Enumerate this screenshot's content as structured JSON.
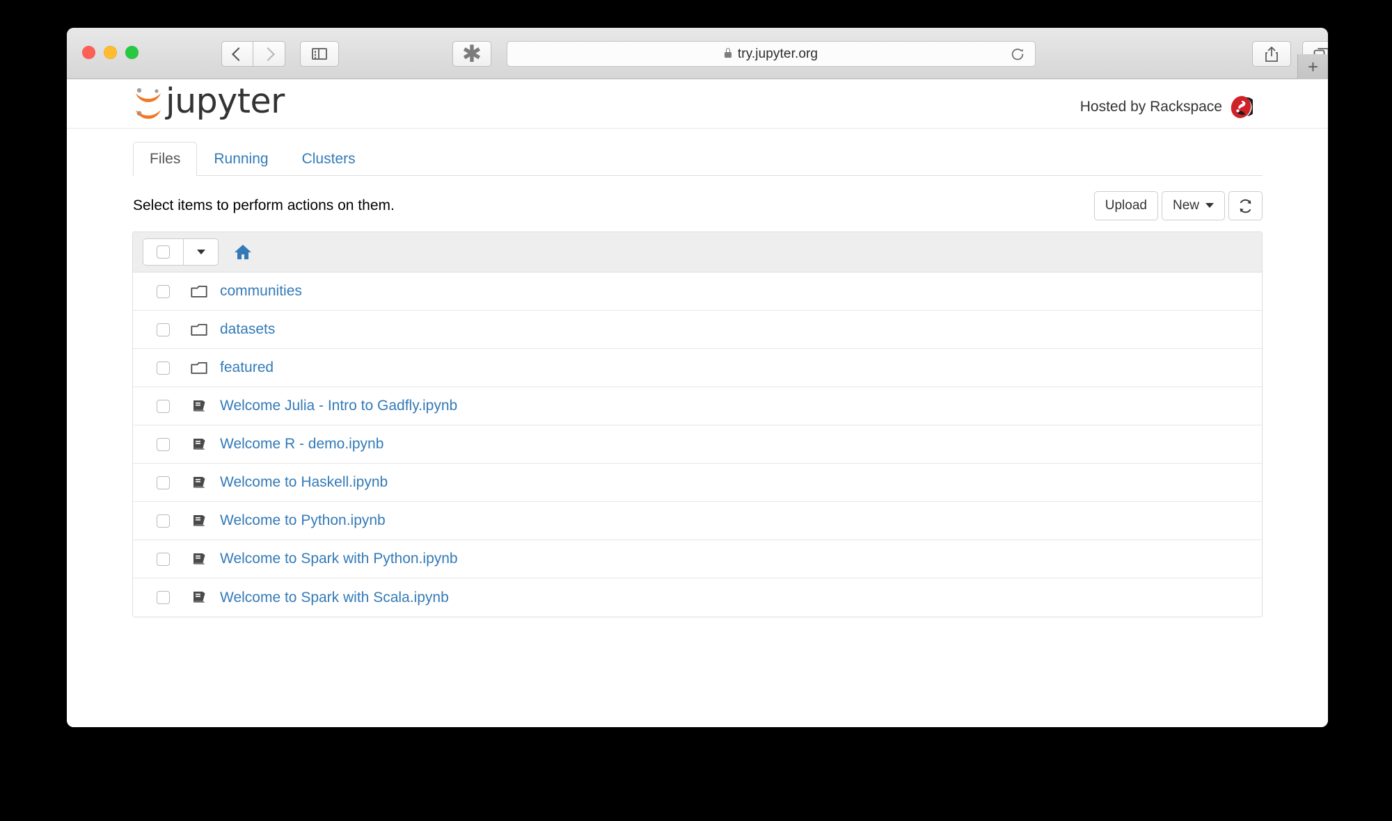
{
  "browser": {
    "url": "try.jupyter.org",
    "lock_icon": "lock-icon",
    "back_icon": "chevron-left-icon",
    "forward_icon": "chevron-right-icon",
    "sidebar_icon": "sidebar-toggle-icon",
    "extension_icon": "asterisk-extension-icon",
    "reload_icon": "reload-icon",
    "share_icon": "share-icon",
    "tab_overview_icon": "tab-overview-icon",
    "new_tab_label": "+"
  },
  "header": {
    "logo_text": "jupyter",
    "logo_icon": "jupyter-logo-icon",
    "hosted_by": "Hosted by Rackspace",
    "rackspace_icon": "rackspace-logo-icon"
  },
  "tabs": [
    {
      "label": "Files",
      "active": true
    },
    {
      "label": "Running",
      "active": false
    },
    {
      "label": "Clusters",
      "active": false
    }
  ],
  "toolbar": {
    "hint": "Select items to perform actions on them.",
    "upload_label": "Upload",
    "new_label": "New",
    "new_caret_icon": "caret-down-icon",
    "refresh_icon": "refresh-icon"
  },
  "filelist": {
    "header": {
      "select_all_checkbox": "",
      "dropdown_icon": "caret-down-icon",
      "breadcrumb_home_icon": "home-icon"
    },
    "rows": [
      {
        "name": "communities",
        "type": "folder",
        "icon": "folder-icon"
      },
      {
        "name": "datasets",
        "type": "folder",
        "icon": "folder-icon"
      },
      {
        "name": "featured",
        "type": "folder",
        "icon": "folder-icon"
      },
      {
        "name": "Welcome Julia - Intro to Gadfly.ipynb",
        "type": "notebook",
        "icon": "notebook-icon"
      },
      {
        "name": "Welcome R - demo.ipynb",
        "type": "notebook",
        "icon": "notebook-icon"
      },
      {
        "name": "Welcome to Haskell.ipynb",
        "type": "notebook",
        "icon": "notebook-icon"
      },
      {
        "name": "Welcome to Python.ipynb",
        "type": "notebook",
        "icon": "notebook-icon"
      },
      {
        "name": "Welcome to Spark with Python.ipynb",
        "type": "notebook",
        "icon": "notebook-icon"
      },
      {
        "name": "Welcome to Spark with Scala.ipynb",
        "type": "notebook",
        "icon": "notebook-icon"
      }
    ]
  },
  "colors": {
    "link": "#337ab7",
    "jupyter_orange": "#f37726",
    "rackspace_red": "#cf2127",
    "traffic_red": "#ff5f57",
    "traffic_yellow": "#febc2e",
    "traffic_green": "#28c840",
    "header_bg": "#eeeeee"
  }
}
